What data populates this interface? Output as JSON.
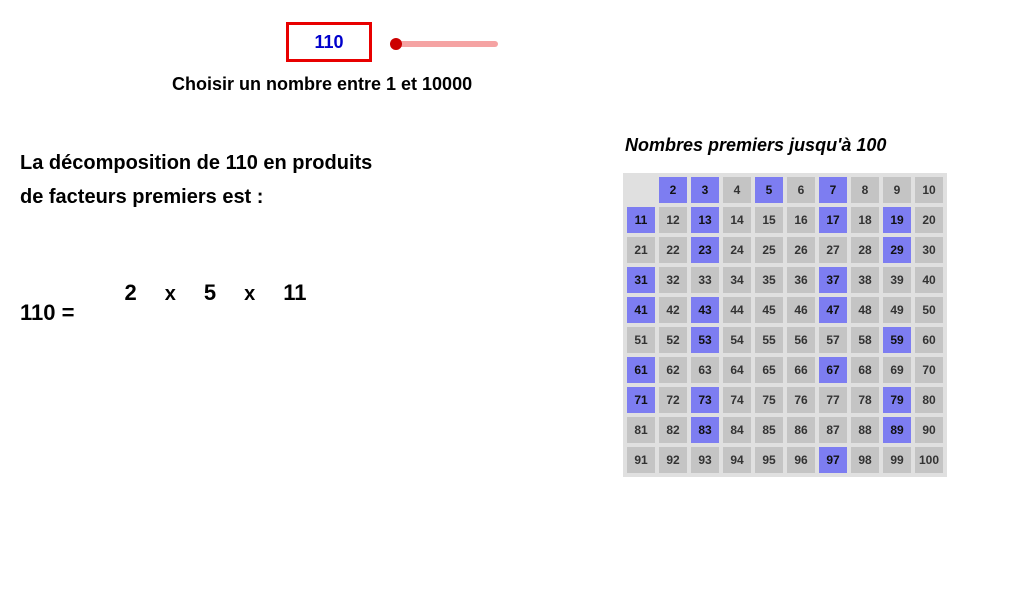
{
  "input": {
    "value": "110",
    "instruction": "Choisir un nombre entre 1 et 10000"
  },
  "slider": {
    "min": 1,
    "max": 10000,
    "value": 110
  },
  "decomposition": {
    "title_line1": "La décomposition de 110 en produits",
    "title_line2": "de facteurs premiers est :",
    "lhs": "110 =",
    "factors": [
      "2",
      "5",
      "11"
    ],
    "times_symbol": "x"
  },
  "prime_table": {
    "title": "Nombres premiers jusqu'à 100",
    "start": 2,
    "end": 100,
    "primes": [
      2,
      3,
      5,
      7,
      11,
      13,
      17,
      19,
      23,
      29,
      31,
      37,
      41,
      43,
      47,
      53,
      59,
      61,
      67,
      71,
      73,
      79,
      83,
      89,
      97
    ]
  }
}
